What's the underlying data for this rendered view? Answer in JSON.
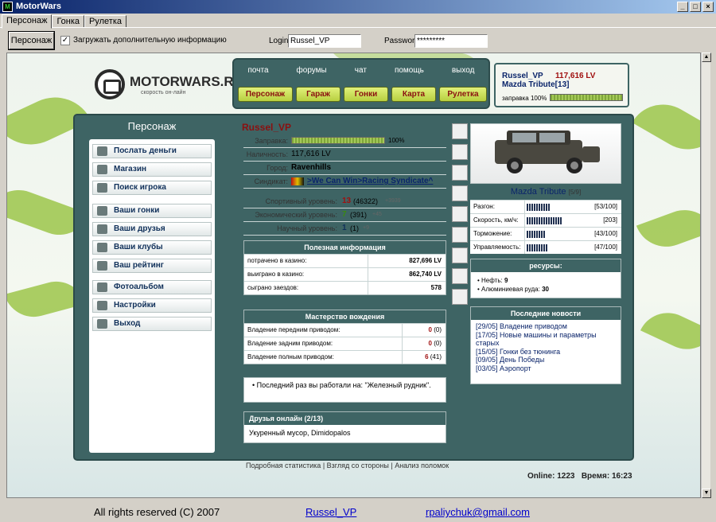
{
  "window": {
    "title": "MotorWars",
    "buttons": [
      "_",
      "□",
      "×"
    ]
  },
  "tabs": [
    "Персонаж",
    "Гонка",
    "Рулетка"
  ],
  "toolbar": {
    "button": "Персонаж",
    "checkbox_label": "Загружать дополнительную информацию",
    "checkbox_mark": "✓",
    "login_label": "Login",
    "login_value": "Russel_VP",
    "password_label": "Password",
    "password_value": "*********"
  },
  "logo": {
    "text": "MOTORWARS.RU",
    "subtitle": "скорость он-лайн"
  },
  "topnav": {
    "links": [
      "почта",
      "форумы",
      "чат",
      "помощь",
      "выход"
    ],
    "buttons": [
      "Персонаж",
      "Гараж",
      "Гонки",
      "Карта",
      "Рулетка"
    ]
  },
  "userbox": {
    "name": "Russel_VP",
    "money": "117,616 LV",
    "car": "Mazda Tribute[13]",
    "fuel_label": "заправка 100%",
    "fuel_fraction": 1.0
  },
  "sidebar": {
    "title": "Персонаж",
    "items": [
      "Послать деньги",
      "Магазин",
      "Поиск игрока",
      "Ваши гонки",
      "Ваши друзья",
      "Ваши клубы",
      "Ваш рейтинг",
      "Фотоальбом",
      "Настройки",
      "Выход"
    ]
  },
  "profile": {
    "title": "Russel_VP",
    "fuel_label": "Заправка:",
    "fuel_value": "100%",
    "cash_label": "Наличность:",
    "cash_value": "117,616 LV",
    "city_label": "Город:",
    "city_value": "Ravenhills",
    "syndicate_label": "Синдикат:",
    "syndicate_value": ">We Can Win>Racing Syndicate^"
  },
  "levels": [
    {
      "label": "Спортивный уровень:",
      "level": "13",
      "points": "(46322)",
      "delta": "+3939"
    },
    {
      "label": "Экономический уровень:",
      "level": "7",
      "points": "(391)",
      "delta": "+45"
    },
    {
      "label": "Научный уровень:",
      "level": "1",
      "points": "(1)",
      "delta": "+9"
    }
  ],
  "useful": {
    "title": "Полезная информация",
    "rows": [
      [
        "потрачено в казино:",
        "827,696 LV"
      ],
      [
        "выиграно в казино:",
        "862,740 LV"
      ],
      [
        "сыграно заездов:",
        "578"
      ]
    ]
  },
  "mastery": {
    "title": "Мастерство вождения",
    "rows": [
      {
        "label": "Владение передним приводом:",
        "value": "0",
        "sub": "(0)"
      },
      {
        "label": "Владение задним приводом:",
        "value": "0",
        "sub": "(0)"
      },
      {
        "label": "Владение полным приводом:",
        "value": "6",
        "sub": "(41)"
      }
    ]
  },
  "lastwork": {
    "text": "Последний раз вы работали на: \"Железный рудник\"."
  },
  "friends": {
    "title": "Друзья онлайн (2/13)",
    "list": "Укуренный мусор, Dimidopalos"
  },
  "car": {
    "name": "Mazda Tribute",
    "level": "[5/9]",
    "stats": [
      {
        "label": "Разгон:",
        "value": "[53/100]",
        "fraction": 0.53
      },
      {
        "label": "Скорость, км/ч:",
        "value": "[203]",
        "fraction": 0.82
      },
      {
        "label": "Торможение:",
        "value": "[43/100]",
        "fraction": 0.43
      },
      {
        "label": "Управляемость:",
        "value": "[47/100]",
        "fraction": 0.47
      }
    ]
  },
  "resources": {
    "title": "ресурсы:",
    "items": [
      {
        "label": "Нефть:",
        "value": "9"
      },
      {
        "label": "Алюминиевая руда:",
        "value": "30"
      }
    ]
  },
  "news": {
    "title": "Последние новости",
    "items": [
      "[29/05] Владение приводом",
      "[17/05] Новые машины и параметры старых",
      "[15/05] Гонки без тюнинга",
      "[09/05] День Победы",
      "[03/05] Аэропорт"
    ]
  },
  "footer_links": [
    "Подробная статистика",
    "Взгляд со стороны",
    "Анализ поломок"
  ],
  "online": {
    "label": "Online:",
    "value": "1223",
    "time_label": "Время:",
    "time_value": "16:23"
  },
  "status": {
    "copyright": "All rights reserved (C) 2007",
    "user": "Russel_VP",
    "email": "rpaliychuk@gmail.com"
  }
}
